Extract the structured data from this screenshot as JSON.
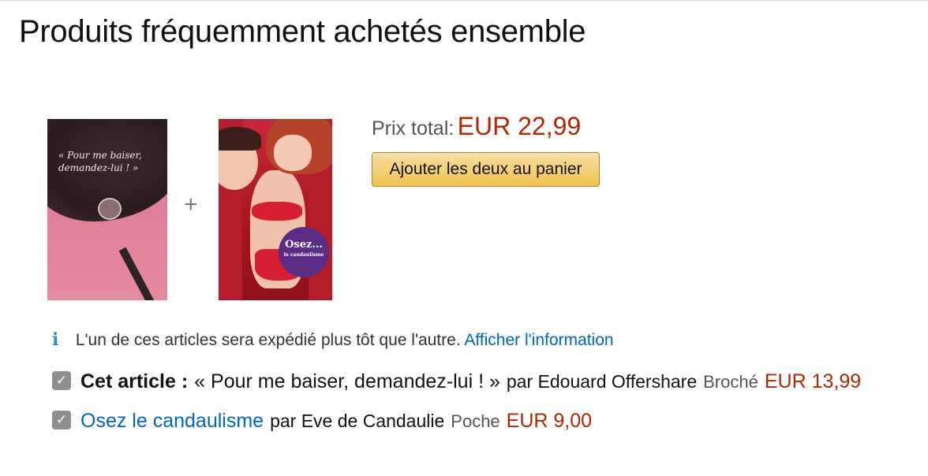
{
  "section": {
    "title": "Produits fréquemment achetés ensemble"
  },
  "bundle": {
    "plus_symbol": "+",
    "total_label": "Prix total:",
    "total_price": "EUR 22,99",
    "add_button_label": "Ajouter les deux au panier",
    "covers": [
      {
        "title_text": "« Pour me baiser, demandez-lui ! »"
      },
      {
        "badge_text": "Osez...",
        "badge_sub": "le candaulisme"
      }
    ]
  },
  "notice": {
    "icon": "info-icon",
    "icon_glyph": "i",
    "text": "L'un de ces articles sera expédié plus tôt que l'autre.",
    "link": "Afficher l'information"
  },
  "items": [
    {
      "checked": true,
      "label_prefix": "Cet article :",
      "title": "« Pour me baiser, demandez-lui ! »",
      "by": "par Edouard Offershare",
      "format": "Broché",
      "price": "EUR 13,99"
    },
    {
      "checked": true,
      "title": "Osez le candaulisme",
      "by": "par Eve de Candaulie",
      "format": "Poche",
      "price": "EUR 9,00"
    }
  ],
  "colors": {
    "price": "#b12704",
    "link": "#0066c0",
    "button": "#f0c14b",
    "info": "#2a8dcf"
  }
}
